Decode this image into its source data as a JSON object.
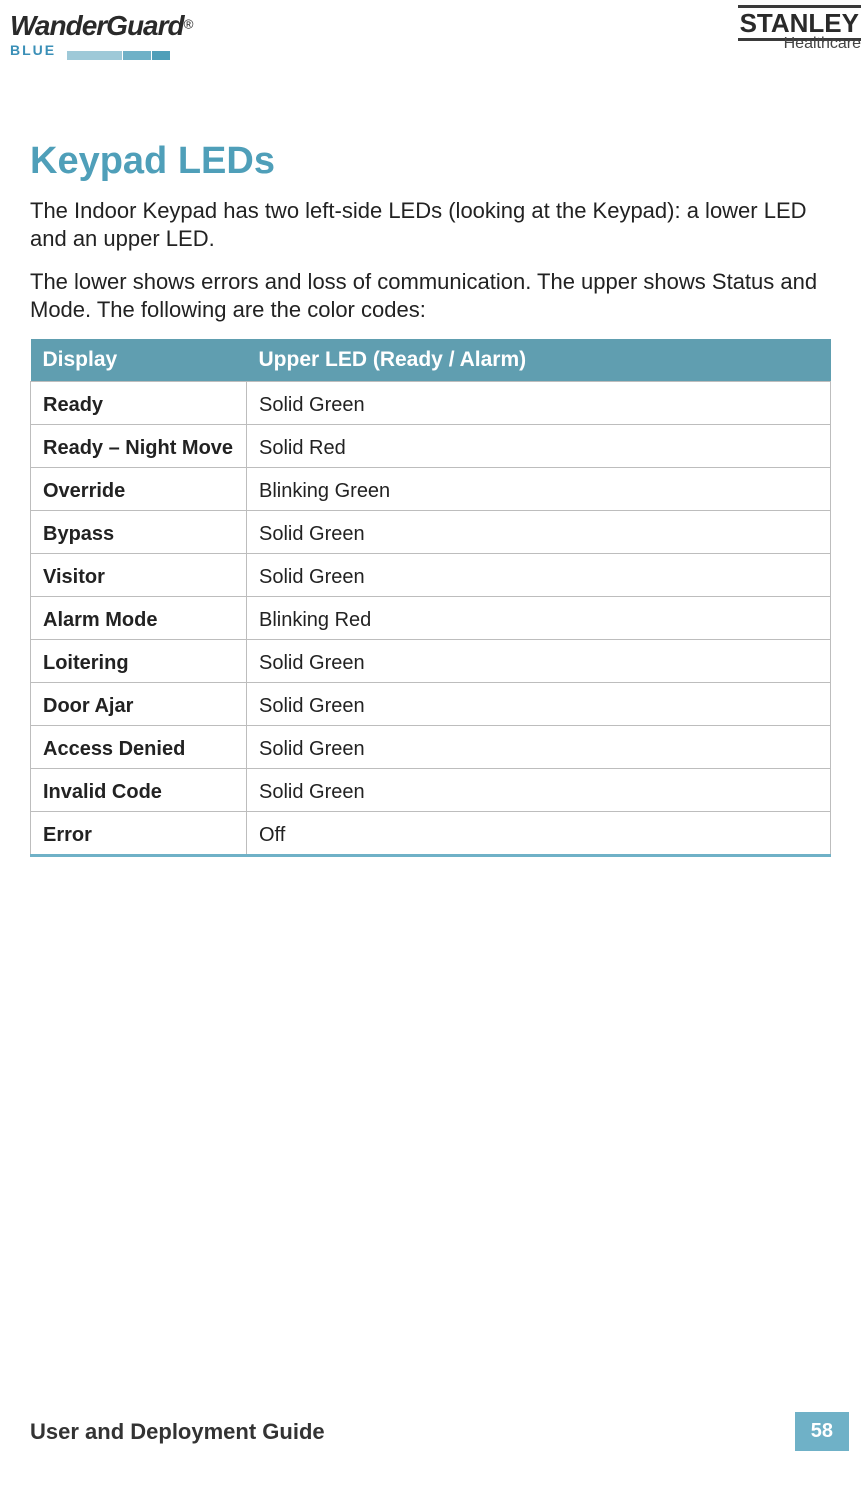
{
  "header": {
    "product_name": "WanderGuard",
    "product_reg": "®",
    "product_sub": "BLUE",
    "company_name": "STANLEY",
    "company_sub": "Healthcare"
  },
  "section": {
    "title": "Keypad LEDs",
    "para1": "The Indoor Keypad has two left-side LEDs (looking at the Keypad): a lower LED and an upper LED.",
    "para2": "The lower shows errors and loss of communication. The upper shows Status and Mode. The following are the color codes:"
  },
  "table": {
    "headers": [
      "Display",
      "Upper LED (Ready / Alarm)"
    ],
    "rows": [
      {
        "display": "Ready",
        "led": "Solid Green"
      },
      {
        "display": "Ready – Night Move",
        "led": "Solid Red"
      },
      {
        "display": "Override",
        "led": "Blinking Green"
      },
      {
        "display": "Bypass",
        "led": "Solid Green"
      },
      {
        "display": "Visitor",
        "led": "Solid Green"
      },
      {
        "display": "Alarm Mode",
        "led": "Blinking Red"
      },
      {
        "display": "Loitering",
        "led": "Solid Green"
      },
      {
        "display": "Door Ajar",
        "led": "Solid Green"
      },
      {
        "display": "Access Denied",
        "led": "Solid Green"
      },
      {
        "display": "Invalid Code",
        "led": "Solid Green"
      },
      {
        "display": "Error",
        "led": "Off"
      }
    ]
  },
  "footer": {
    "title": "User and Deployment Guide",
    "page": "58"
  }
}
